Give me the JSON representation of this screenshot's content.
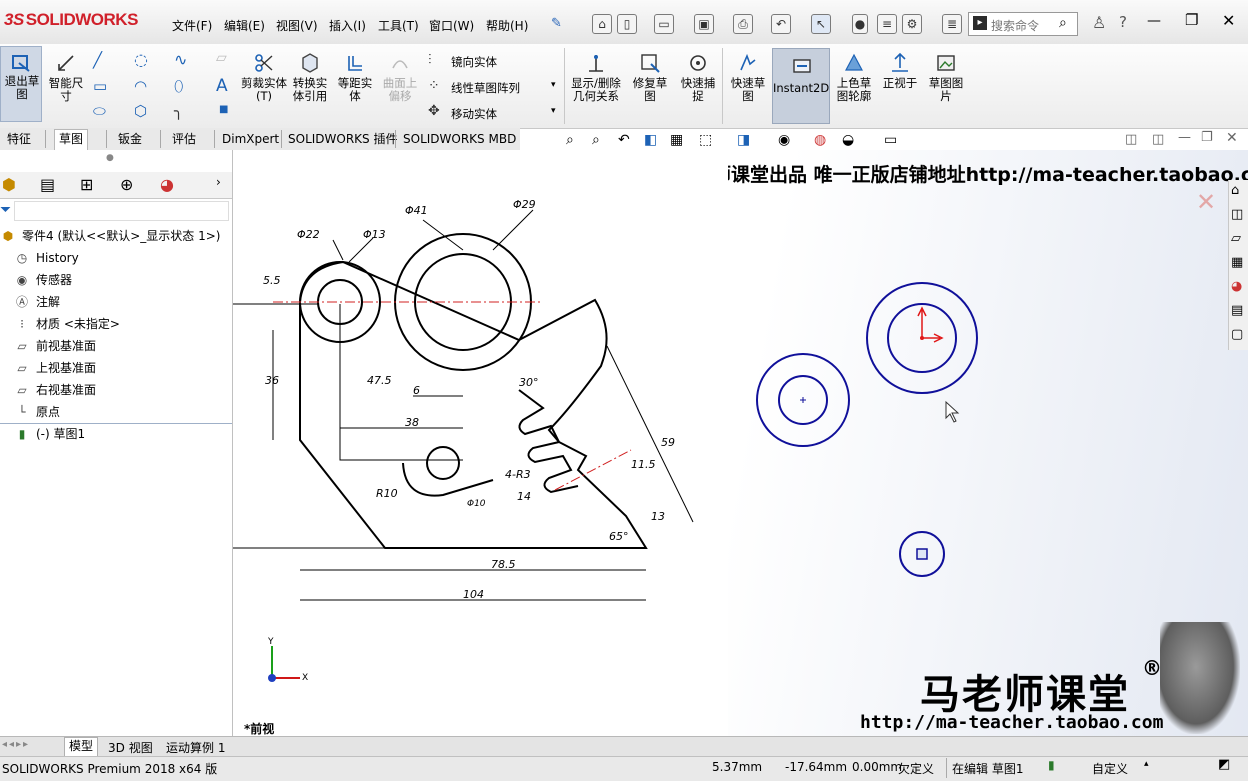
{
  "app": {
    "logo_ds": "3S",
    "logo_text": "SOLIDWORKS"
  },
  "menu": [
    "文件(F)",
    "编辑(E)",
    "视图(V)",
    "插入(I)",
    "工具(T)",
    "窗口(W)",
    "帮助(H)"
  ],
  "search": {
    "placeholder": "搜索命令"
  },
  "commands": {
    "exit_sketch": "退出草图",
    "smart_dim": "智能尺寸",
    "trim": "剪裁实体(T)",
    "convert": "转换实体引用",
    "offset": "等距实体",
    "surface_offset": "曲面上偏移",
    "mirror": "镜向实体",
    "linear_pattern": "线性草图阵列",
    "move": "移动实体",
    "show_relations": "显示/删除几何关系",
    "repair": "修复草图",
    "quick_snap": "快速捕捉",
    "rapid_sketch": "快速草图",
    "instant2d": "Instant2D",
    "shaded": "上色草图轮廓",
    "normal_to": "正视于",
    "sketch_picture": "草图图片"
  },
  "tabs": [
    "特征",
    "草图",
    "钣金",
    "评估",
    "DimXpert",
    "SOLIDWORKS 插件",
    "SOLIDWORKS MBD"
  ],
  "tree": {
    "root": "零件4  (默认<<默认>_显示状态 1>)",
    "items": [
      "History",
      "传感器",
      "注解",
      "材质 <未指定>",
      "前视基准面",
      "上视基准面",
      "右视基准面",
      "原点",
      "(-) 草图1"
    ]
  },
  "watermark": {
    "top": "淘宝马老师课堂出品 唯一正版店铺地址http://ma-teacher.taobao.com",
    "brand": "马老师课堂",
    "reg": "®",
    "url": "http://ma-teacher.taobao.com"
  },
  "drawing": {
    "dims": [
      "Φ41",
      "Φ29",
      "Φ22",
      "Φ13",
      "5.5",
      "36",
      "47.5",
      "6",
      "38",
      "30°",
      "59",
      "11.5",
      "4-R3",
      "14",
      "13",
      "R10",
      "Φ10",
      "78.5",
      "104",
      "65°"
    ]
  },
  "view_label": "*前视",
  "axis": {
    "x": "X",
    "y": "Y"
  },
  "bottom_tabs": [
    "模型",
    "3D 视图",
    "运动算例 1"
  ],
  "status": {
    "product": "SOLIDWORKS Premium 2018 x64 版",
    "x": "5.37mm",
    "y": "-17.64mm",
    "z": "0.00mm",
    "state": "欠定义",
    "editing": "在编辑 草图1",
    "custom": "自定义"
  }
}
